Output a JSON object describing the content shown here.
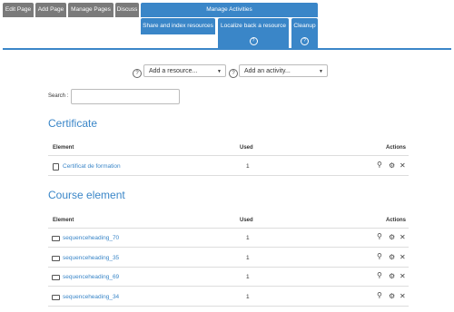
{
  "top_tabs": [
    "Edit Page",
    "Add Page",
    "Manage Pages",
    "Discuss",
    "Manage Activities"
  ],
  "sub_tabs": [
    "Share and index resources",
    "Localize back a resource",
    "Cleanup"
  ],
  "help_symbol": "?",
  "add_resource": {
    "label": "Add a resource...",
    "caret": "▼"
  },
  "add_activity": {
    "label": "Add an activity...",
    "caret": "▼"
  },
  "search_label": "Search :",
  "columns": {
    "element": "Element",
    "used": "Used",
    "actions": "Actions"
  },
  "icons": {
    "search": "⚲",
    "gear": "⚙",
    "close": "✕"
  },
  "sections": [
    {
      "title": "Certificate",
      "rows": [
        {
          "name": "Certificat de formation",
          "used": "1",
          "icon": "certificate-icon"
        }
      ]
    },
    {
      "title": "Course element",
      "rows": [
        {
          "name": "sequenceheading_70",
          "used": "1",
          "icon": "heading-icon"
        },
        {
          "name": "sequenceheading_35",
          "used": "1",
          "icon": "heading-icon"
        },
        {
          "name": "sequenceheading_69",
          "used": "1",
          "icon": "heading-icon"
        },
        {
          "name": "sequenceheading_34",
          "used": "1",
          "icon": "heading-icon"
        }
      ]
    }
  ]
}
